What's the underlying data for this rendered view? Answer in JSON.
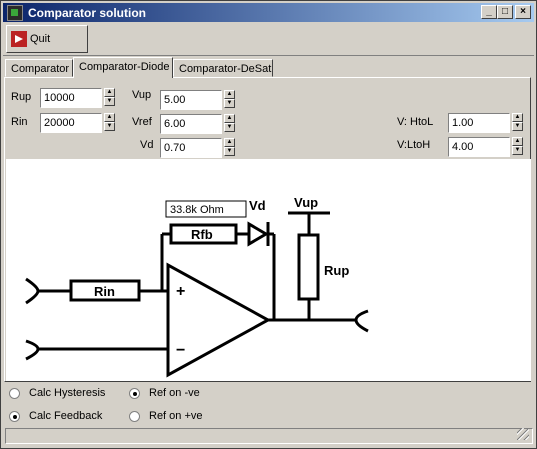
{
  "window": {
    "title": "Comparator solution",
    "buttons": [
      "_",
      "□",
      "×"
    ]
  },
  "toolbar": {
    "quit_label": "Quit",
    "quit_icon": "exit-icon"
  },
  "tabs": [
    {
      "label": "Comparator",
      "active": false
    },
    {
      "label": "Comparator-Diode",
      "active": true
    },
    {
      "label": "Comparator-DeSat",
      "active": false
    }
  ],
  "fields": {
    "rup": {
      "label": "Rup",
      "value": "10000"
    },
    "rin": {
      "label": "Rin",
      "value": "20000"
    },
    "vup": {
      "label": "Vup",
      "value": "5.00"
    },
    "vref": {
      "label": "Vref",
      "value": "6.00"
    },
    "vd": {
      "label": "Vd",
      "value": "0.70"
    },
    "v_htol": {
      "label": "V: HtoL",
      "value": "1.00"
    },
    "v_ltoh": {
      "label": "V:LtoH",
      "value": "4.00"
    }
  },
  "diagram": {
    "rfb_value": "33.8k Ohm",
    "vd_label": "Vd",
    "vup_label": "Vup",
    "rfb_label": "Rfb",
    "rup_label": "Rup",
    "rin_label": "Rin",
    "plus": "+",
    "minus": "−"
  },
  "options": {
    "calc_hysteresis": {
      "label": "Calc Hysteresis",
      "checked": false
    },
    "calc_feedback": {
      "label": "Calc Feedback",
      "checked": true
    },
    "ref_neg": {
      "label": "Ref on -ve",
      "checked": true
    },
    "ref_pos": {
      "label": "Ref on +ve",
      "checked": false
    }
  },
  "colors": {
    "titlebar_start": "#0a246a",
    "titlebar_end": "#a6caf0",
    "face": "#d4d0c8"
  }
}
